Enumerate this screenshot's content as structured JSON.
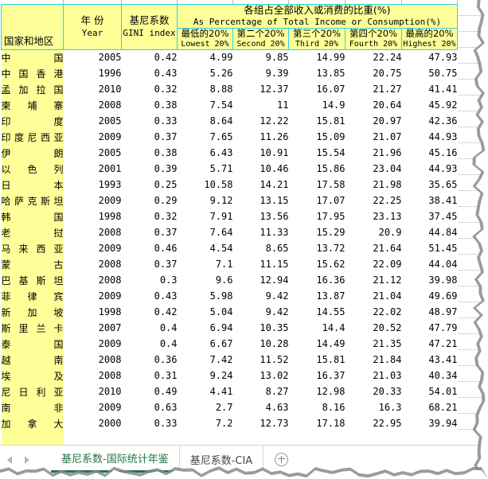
{
  "workbook": {
    "accent_color": "#217346",
    "header_fill": "#ffff99",
    "header_border": "#2ad2e6"
  },
  "table": {
    "corner_label_cn": "国家和地区",
    "columns": [
      {
        "cn": "年 份",
        "en": "Year"
      },
      {
        "cn": "基尼系数",
        "en": "GINI index"
      }
    ],
    "group_header": {
      "cn": "各组占全部收入或消费的比重(%)",
      "en": "As Percentage of Total Income or Consumption(%)"
    },
    "sub_columns": [
      {
        "cn": "最低的20%",
        "en": "Lowest 20%"
      },
      {
        "cn": "第二个20%",
        "en": "Second 20%"
      },
      {
        "cn": "第三个20%",
        "en": "Third 20%"
      },
      {
        "cn": "第四个20%",
        "en": "Fourth 20%"
      },
      {
        "cn": "最高的20%",
        "en": "Highest 20%"
      }
    ],
    "rows": [
      {
        "country": "中国",
        "year": "2005",
        "gini": "0.42",
        "q1": "4.99",
        "q2": "9.85",
        "q3": "14.99",
        "q4": "22.24",
        "q5": "47.93"
      },
      {
        "country": "中国香港",
        "year": "1996",
        "gini": "0.43",
        "q1": "5.26",
        "q2": "9.39",
        "q3": "13.85",
        "q4": "20.75",
        "q5": "50.75"
      },
      {
        "country": "孟加拉国",
        "year": "2010",
        "gini": "0.32",
        "q1": "8.88",
        "q2": "12.37",
        "q3": "16.07",
        "q4": "21.27",
        "q5": "41.41"
      },
      {
        "country": "柬埔寨",
        "year": "2008",
        "gini": "0.38",
        "q1": "7.54",
        "q2": "11",
        "q3": "14.9",
        "q4": "20.64",
        "q5": "45.92"
      },
      {
        "country": "印度",
        "year": "2005",
        "gini": "0.33",
        "q1": "8.64",
        "q2": "12.22",
        "q3": "15.81",
        "q4": "20.97",
        "q5": "42.36"
      },
      {
        "country": "印度尼西亚",
        "year": "2009",
        "gini": "0.37",
        "q1": "7.65",
        "q2": "11.26",
        "q3": "15.09",
        "q4": "21.07",
        "q5": "44.93"
      },
      {
        "country": "伊朗",
        "year": "2005",
        "gini": "0.38",
        "q1": "6.43",
        "q2": "10.91",
        "q3": "15.54",
        "q4": "21.96",
        "q5": "45.16"
      },
      {
        "country": "以色列",
        "year": "2001",
        "gini": "0.39",
        "q1": "5.71",
        "q2": "10.46",
        "q3": "15.86",
        "q4": "23.04",
        "q5": "44.93"
      },
      {
        "country": "日本",
        "year": "1993",
        "gini": "0.25",
        "q1": "10.58",
        "q2": "14.21",
        "q3": "17.58",
        "q4": "21.98",
        "q5": "35.65"
      },
      {
        "country": "哈萨克斯坦",
        "year": "2009",
        "gini": "0.29",
        "q1": "9.12",
        "q2": "13.15",
        "q3": "17.07",
        "q4": "22.25",
        "q5": "38.41"
      },
      {
        "country": "韩国",
        "year": "1998",
        "gini": "0.32",
        "q1": "7.91",
        "q2": "13.56",
        "q3": "17.95",
        "q4": "23.13",
        "q5": "37.45"
      },
      {
        "country": "老挝",
        "year": "2008",
        "gini": "0.37",
        "q1": "7.64",
        "q2": "11.33",
        "q3": "15.29",
        "q4": "20.9",
        "q5": "44.84"
      },
      {
        "country": "马来西亚",
        "year": "2009",
        "gini": "0.46",
        "q1": "4.54",
        "q2": "8.65",
        "q3": "13.72",
        "q4": "21.64",
        "q5": "51.45"
      },
      {
        "country": "蒙古",
        "year": "2008",
        "gini": "0.37",
        "q1": "7.1",
        "q2": "11.15",
        "q3": "15.62",
        "q4": "22.09",
        "q5": "44.04"
      },
      {
        "country": "巴基斯坦",
        "year": "2008",
        "gini": "0.3",
        "q1": "9.6",
        "q2": "12.94",
        "q3": "16.36",
        "q4": "21.12",
        "q5": "39.98"
      },
      {
        "country": "菲律宾",
        "year": "2009",
        "gini": "0.43",
        "q1": "5.98",
        "q2": "9.42",
        "q3": "13.87",
        "q4": "21.04",
        "q5": "49.69"
      },
      {
        "country": "新加坡",
        "year": "1998",
        "gini": "0.42",
        "q1": "5.04",
        "q2": "9.42",
        "q3": "14.55",
        "q4": "22.02",
        "q5": "48.97"
      },
      {
        "country": "斯里兰卡",
        "year": "2007",
        "gini": "0.4",
        "q1": "6.94",
        "q2": "10.35",
        "q3": "14.4",
        "q4": "20.52",
        "q5": "47.79"
      },
      {
        "country": "泰国",
        "year": "2009",
        "gini": "0.4",
        "q1": "6.67",
        "q2": "10.28",
        "q3": "14.49",
        "q4": "21.35",
        "q5": "47.21"
      },
      {
        "country": "越南",
        "year": "2008",
        "gini": "0.36",
        "q1": "7.42",
        "q2": "11.52",
        "q3": "15.81",
        "q4": "21.84",
        "q5": "43.41"
      },
      {
        "country": "埃及",
        "year": "2008",
        "gini": "0.31",
        "q1": "9.24",
        "q2": "13.02",
        "q3": "16.37",
        "q4": "21.03",
        "q5": "40.34"
      },
      {
        "country": "尼日利亚",
        "year": "2010",
        "gini": "0.49",
        "q1": "4.41",
        "q2": "8.27",
        "q3": "12.98",
        "q4": "20.33",
        "q5": "54.01"
      },
      {
        "country": "南非",
        "year": "2009",
        "gini": "0.63",
        "q1": "2.7",
        "q2": "4.63",
        "q3": "8.16",
        "q4": "16.3",
        "q5": "68.21"
      },
      {
        "country": "加拿大",
        "year": "2000",
        "gini": "0.33",
        "q1": "7.2",
        "q2": "12.73",
        "q3": "17.18",
        "q4": "22.95",
        "q5": "39.94"
      }
    ]
  },
  "sheet_tabs": {
    "items": [
      {
        "label": "基尼系数-国际统计年鉴",
        "active": true
      },
      {
        "label": "基尼系数-CIA",
        "active": false
      }
    ],
    "add_sheet_title": "+",
    "nav_prev": "◀",
    "nav_next": "▶"
  }
}
